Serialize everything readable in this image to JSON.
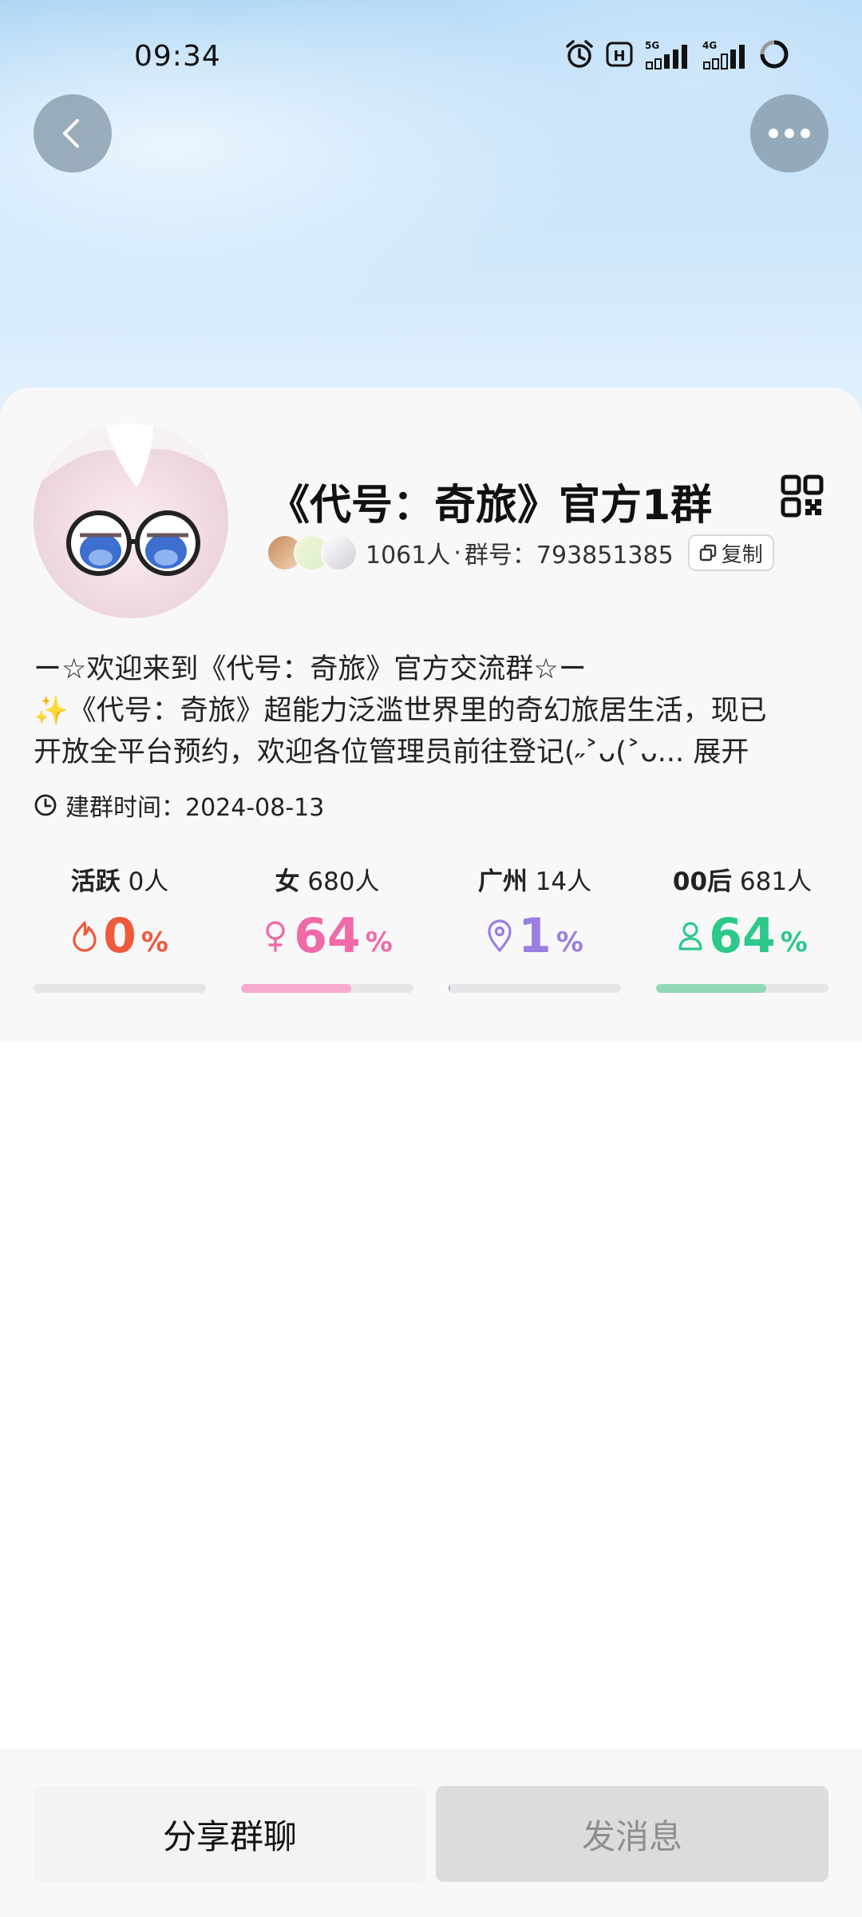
{
  "status_bar": {
    "time": "09:34",
    "network_1": "5G",
    "network_2": "4G"
  },
  "header": {
    "back_icon": "chevron-left-icon",
    "more_icon": "more-dots-icon"
  },
  "group": {
    "name": "《代号：奇旅》官方1群",
    "member_count": "1061人",
    "separator": "·",
    "group_number": "群号：793851385",
    "copy_label": "复制",
    "intro_line1": "ー☆欢迎来到《代号：奇旅》官方交流群☆ー",
    "intro_line2": "✨《代号：奇旅》超能力泛滥世界里的奇幻旅居生活，现已",
    "intro_line3": "开放全平台预约，欢迎各位管理员前往登记(˶˃ᴗ(˃ᴗ...",
    "expand_label": "展开",
    "created_label": "建群时间：2024-08-13"
  },
  "stats": [
    {
      "label": "活跃",
      "count": "0人",
      "value": "0",
      "pct": "%",
      "fraction": 0.0,
      "color": "#ef5a3c",
      "icon": "flame-icon"
    },
    {
      "label": "女",
      "count": "680人",
      "value": "64",
      "pct": "%",
      "fraction": 0.64,
      "color": "#f06aa8",
      "bar_color": "#f8a9ce",
      "icon": "female-icon"
    },
    {
      "label": "广州",
      "count": "14人",
      "value": "1",
      "pct": "%",
      "fraction": 0.01,
      "color": "#9b7fe0",
      "bar_color": "#aaa3c8",
      "icon": "location-pin-icon"
    },
    {
      "label": "00后",
      "count": "681人",
      "value": "64",
      "pct": "%",
      "fraction": 0.64,
      "color": "#2cc98a",
      "bar_color": "#8fd9b5",
      "icon": "person-icon"
    }
  ],
  "actions": {
    "share_label": "分享群聊",
    "send_label": "发消息"
  }
}
